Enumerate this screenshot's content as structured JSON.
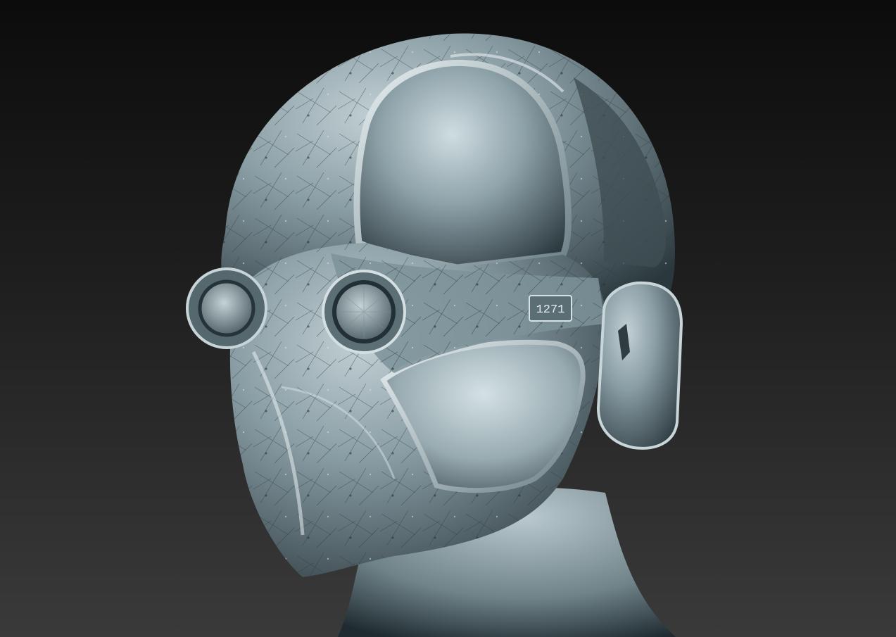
{
  "scene": {
    "subject": "sculpted-helmet-mask-on-mannequin-head",
    "background_top_color": "#0c0c0c",
    "background_bottom_color": "#3a3a3a",
    "material_base_color": "#8fa3ab",
    "material_highlight_color": "#dfe9ec",
    "material_shadow_color": "#1e2a2f",
    "badge_text": "1271"
  }
}
